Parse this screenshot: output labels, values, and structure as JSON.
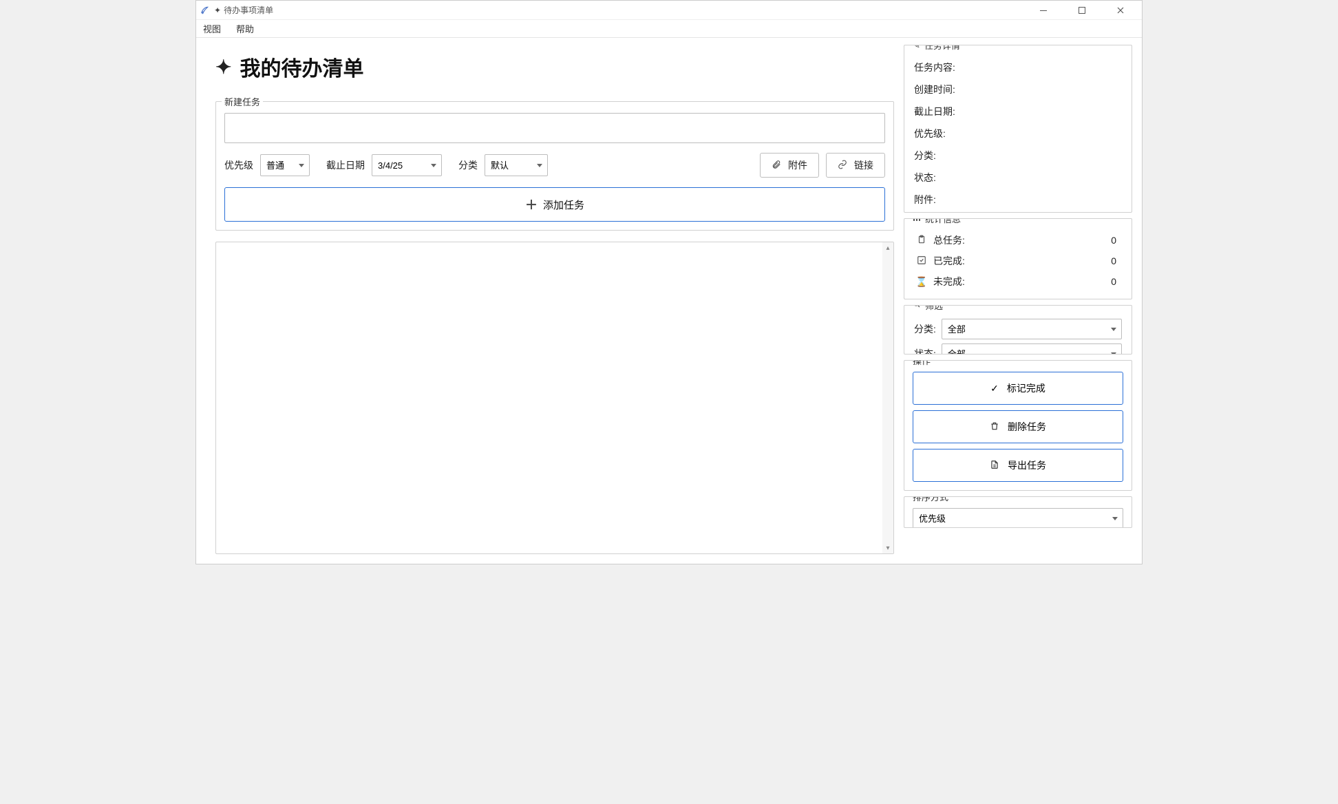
{
  "window": {
    "title": "待办事项清单"
  },
  "menubar": {
    "view": "视图",
    "help": "帮助"
  },
  "heading": "我的待办清单",
  "newtask": {
    "legend": "新建任务",
    "input_value": "",
    "priority_label": "优先级",
    "priority_value": "普通",
    "deadline_label": "截止日期",
    "deadline_value": "3/4/25",
    "category_label": "分类",
    "category_value": "默认",
    "attachment_btn": "附件",
    "link_btn": "链接",
    "add_btn": "添加任务"
  },
  "details": {
    "legend": "任务详情",
    "rows": {
      "content": "任务内容:",
      "created": "创建时间:",
      "deadline": "截止日期:",
      "priority": "优先级:",
      "category": "分类:",
      "status": "状态:",
      "attachment": "附件:"
    }
  },
  "stats": {
    "legend": "统计信息",
    "total_label": "总任务:",
    "total_value": "0",
    "done_label": "已完成:",
    "done_value": "0",
    "undone_label": "未完成:",
    "undone_value": "0"
  },
  "filter": {
    "legend": "筛选",
    "category_label": "分类:",
    "category_value": "全部",
    "status_label": "状态:",
    "status_value": "全部"
  },
  "ops": {
    "legend": "操作",
    "complete": "标记完成",
    "delete": "删除任务",
    "export": "导出任务"
  },
  "sort": {
    "legend": "排序方式",
    "value": "优先级"
  }
}
